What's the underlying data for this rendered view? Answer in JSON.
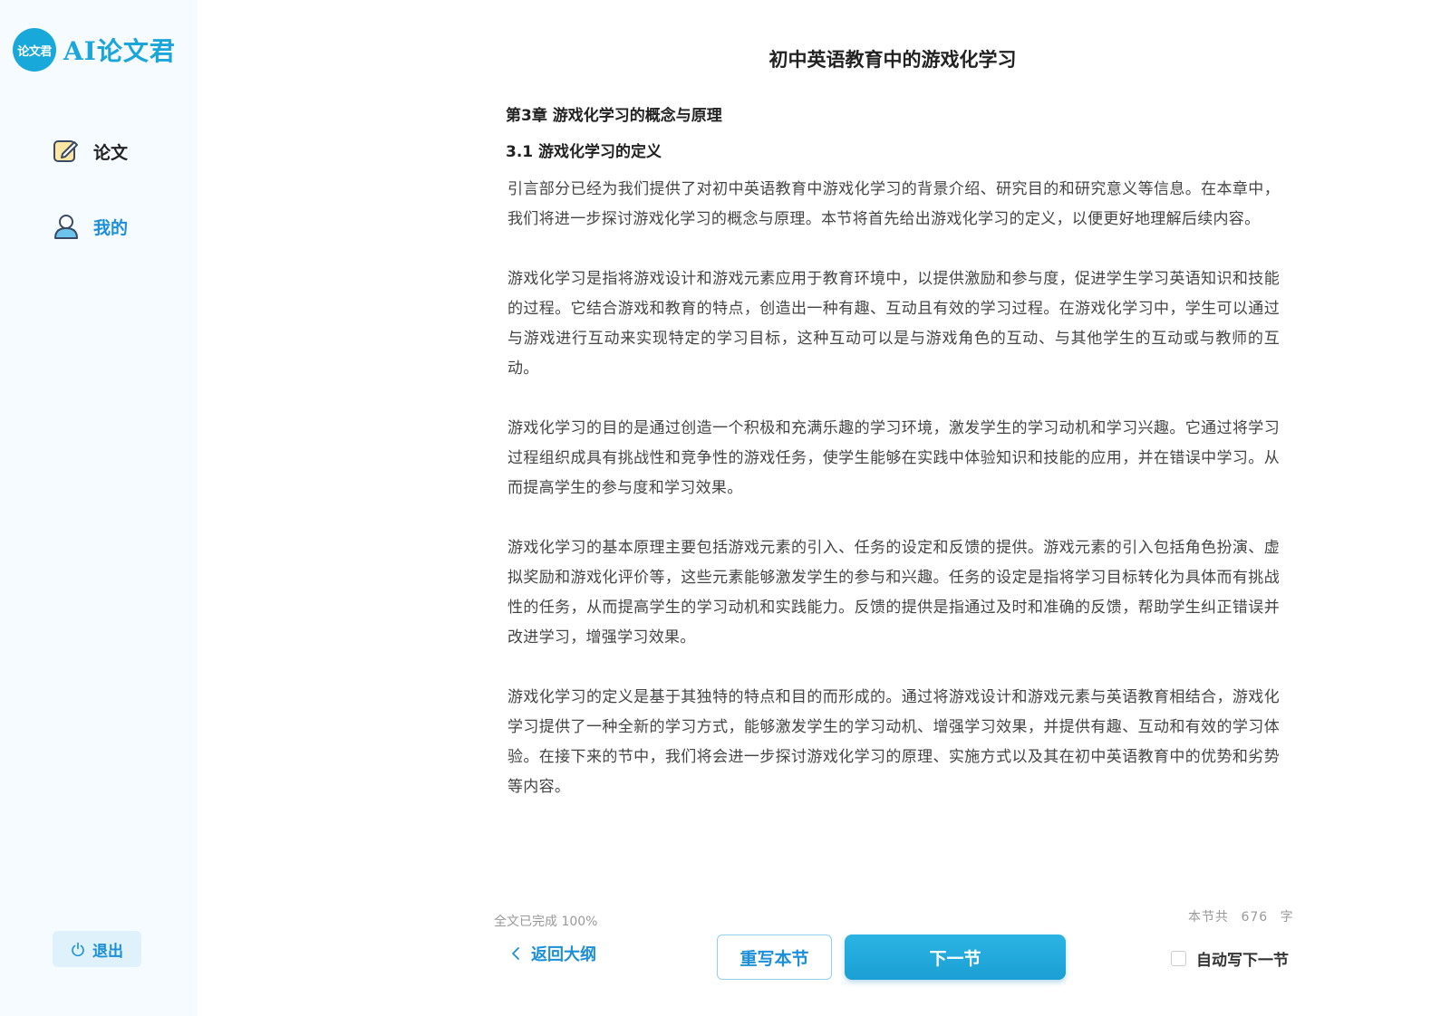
{
  "app": {
    "logo_badge": "论文君",
    "logo_text": "AI论文君",
    "accent_color": "#1c8fd9"
  },
  "sidebar": {
    "items": [
      {
        "label": "论文",
        "icon": "edit-icon",
        "active": false
      },
      {
        "label": "我的",
        "icon": "user-icon",
        "active": true
      }
    ],
    "logout_label": "退出"
  },
  "document": {
    "title": "初中英语教育中的游戏化学习",
    "chapter": "第3章 游戏化学习的概念与原理",
    "section": "3.1 游戏化学习的定义",
    "paragraphs": [
      "引言部分已经为我们提供了对初中英语教育中游戏化学习的背景介绍、研究目的和研究意义等信息。在本章中，我们将进一步探讨游戏化学习的概念与原理。本节将首先给出游戏化学习的定义，以便更好地理解后续内容。",
      "游戏化学习是指将游戏设计和游戏元素应用于教育环境中，以提供激励和参与度，促进学生学习英语知识和技能的过程。它结合游戏和教育的特点，创造出一种有趣、互动且有效的学习过程。在游戏化学习中，学生可以通过与游戏进行互动来实现特定的学习目标，这种互动可以是与游戏角色的互动、与其他学生的互动或与教师的互动。",
      "游戏化学习的目的是通过创造一个积极和充满乐趣的学习环境，激发学生的学习动机和学习兴趣。它通过将学习过程组织成具有挑战性和竞争性的游戏任务，使学生能够在实践中体验知识和技能的应用，并在错误中学习。从而提高学生的参与度和学习效果。",
      "游戏化学习的基本原理主要包括游戏元素的引入、任务的设定和反馈的提供。游戏元素的引入包括角色扮演、虚拟奖励和游戏化评价等，这些元素能够激发学生的参与和兴趣。任务的设定是指将学习目标转化为具体而有挑战性的任务，从而提高学生的学习动机和实践能力。反馈的提供是指通过及时和准确的反馈，帮助学生纠正错误并改进学习，增强学习效果。",
      "游戏化学习的定义是基于其独特的特点和目的而形成的。通过将游戏设计和游戏元素与英语教育相结合，游戏化学习提供了一种全新的学习方式，能够激发学生的学习动机、增强学习效果，并提供有趣、互动和有效的学习体验。在接下来的节中，我们将会进一步探讨游戏化学习的原理、实施方式以及其在初中英语教育中的优势和劣势等内容。"
    ]
  },
  "footer": {
    "progress_text": "全文已完成 100%",
    "progress_percent": 100,
    "back_label": "返回大纲",
    "rewrite_label": "重写本节",
    "next_label": "下一节",
    "word_count_prefix": "本节共",
    "word_count": "676",
    "word_count_suffix": "字",
    "auto_next_label": "自动写下一节",
    "auto_next_checked": false
  }
}
